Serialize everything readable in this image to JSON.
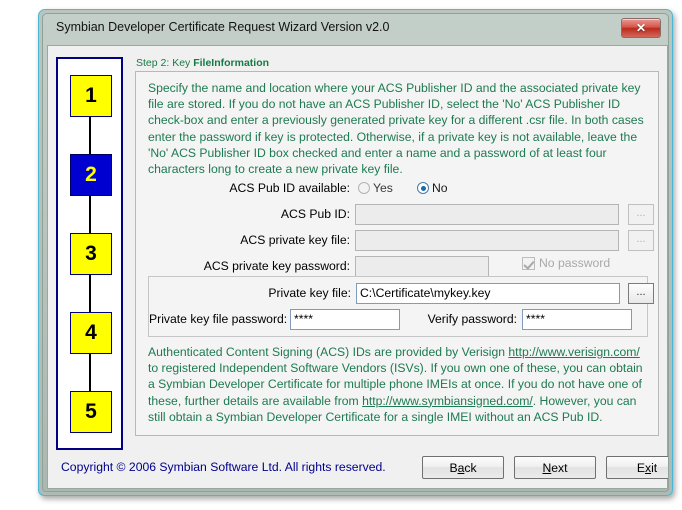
{
  "window": {
    "title": "Symbian Developer Certificate Request Wizard Version v2.0",
    "close_label": "✕"
  },
  "steps": {
    "items": [
      {
        "number": "1",
        "active": false
      },
      {
        "number": "2",
        "active": true
      },
      {
        "number": "3",
        "active": false
      },
      {
        "number": "4",
        "active": false
      },
      {
        "number": "5",
        "active": false
      }
    ]
  },
  "content": {
    "heading_prefix": "Step 2: Key ",
    "heading_bold": "FileInformation",
    "description": "Specify the name and location where your ACS Publisher ID and the associated private key file are stored. If you do not have an ACS Publisher ID, select the 'No' ACS Publisher ID check-box and enter a previously generated private key for a different .csr file. In both cases enter the password if key is protected. Otherwise, if a private key is not available, leave the 'No' ACS Publisher ID box checked and enter a name and a password of at least four characters long to create a new private key file."
  },
  "form": {
    "acs_available_label": "ACS Pub ID available:",
    "radio_yes": "Yes",
    "radio_no": "No",
    "selected": "No",
    "acs_pub_id_label": "ACS Pub ID:",
    "acs_pub_id_value": "",
    "acs_private_key_file_label": "ACS private key file:",
    "acs_private_key_file_value": "",
    "acs_private_key_password_label": "ACS private key password:",
    "acs_private_key_password_value": "",
    "no_password_label": "No password",
    "no_password_checked": true,
    "browse_label": "...",
    "private_key_file_label": "Private key file:",
    "private_key_file_value": "C:\\Certificate\\mykey.key",
    "private_key_password_label": "Private key file password:",
    "private_key_password_value": "****",
    "verify_password_label": "Verify password:",
    "verify_password_value": "****"
  },
  "acs_info": {
    "part1": "Authenticated Content Signing (ACS) IDs are provided by Verisign ",
    "link1": "http://www.verisign.com/",
    "part2": " to registered Independent Software Vendors (ISVs). If you own one of these, you can obtain a Symbian Developer Certificate for multiple phone IMEIs at once. If you do not have one of these, further details are available from ",
    "link2": "http://www.symbiansigned.com/",
    "part3": ". However, you can still obtain a Symbian Developer Certificate for a single IMEI without an ACS Pub ID."
  },
  "footer": {
    "copyright": "Copyright © 2006 Symbian Software Ltd. All rights reserved.",
    "back_pre": "B",
    "back_accel": "a",
    "back_post": "ck",
    "next_pre": "",
    "next_accel": "N",
    "next_post": "ext",
    "exit_pre": "E",
    "exit_accel": "x",
    "exit_post": "it"
  },
  "colors": {
    "heading_green": "#167a45",
    "body_green": "#1e7a52",
    "copyright_blue": "#00008b",
    "step_active_bg": "#0000d0",
    "step_bg": "#ffff00",
    "step_border": "#000080"
  }
}
